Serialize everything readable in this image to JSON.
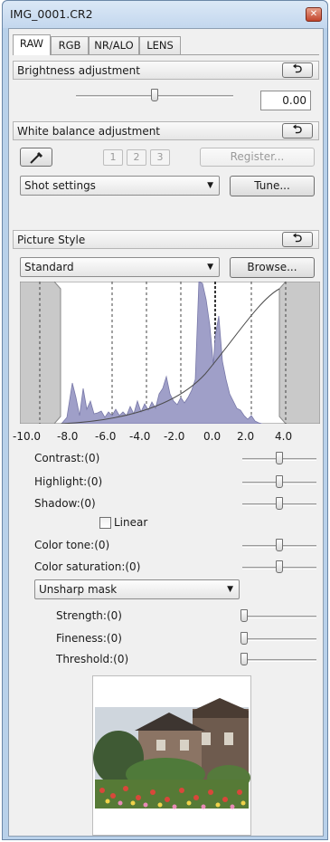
{
  "window": {
    "title": "IMG_0001.CR2"
  },
  "tabs": [
    {
      "label": "RAW"
    },
    {
      "label": "RGB"
    },
    {
      "label": "NR/ALO"
    },
    {
      "label": "LENS"
    }
  ],
  "brightness": {
    "header": "Brightness adjustment",
    "value": "0.00",
    "slider_level": 0.5
  },
  "white_balance": {
    "header": "White balance adjustment",
    "presets": [
      "1",
      "2",
      "3"
    ],
    "register_label": "Register...",
    "mode": "Shot settings",
    "tune_label": "Tune..."
  },
  "picture_style": {
    "header": "Picture Style",
    "style": "Standard",
    "browse_label": "Browse...",
    "histogram_axis": [
      "-10.0",
      "-8.0",
      "-6.0",
      "-4.0",
      "-2.0",
      "0.0",
      "2.0",
      "4.0"
    ],
    "params": [
      {
        "label": "Contrast:(0)"
      },
      {
        "label": "Highlight:(0)"
      },
      {
        "label": "Shadow:(0)"
      }
    ],
    "linear_label": "Linear",
    "linear_checked": false,
    "color_params": [
      {
        "label": "Color tone:(0)"
      },
      {
        "label": "Color saturation:(0)"
      }
    ],
    "sharpness_mode": "Unsharp mask",
    "sharp_params": [
      {
        "label": "Strength:(0)"
      },
      {
        "label": "Fineness:(0)"
      },
      {
        "label": "Threshold:(0)"
      }
    ]
  },
  "colors": {
    "histogram_fill": "#9f9fc8",
    "window_frame": "#b9d1ea",
    "panel": "#f0f0f0"
  },
  "icons": {
    "reset": "undo-arrow-icon",
    "eyedropper": "eyedropper-icon",
    "close": "close-icon",
    "dropdown": "chevron-down-icon"
  }
}
